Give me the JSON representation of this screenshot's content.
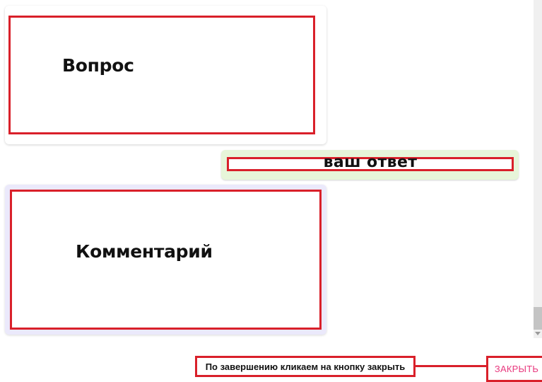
{
  "question": {
    "text": "Вопрос"
  },
  "answer": {
    "text": "ваш ответ"
  },
  "comment": {
    "text": "Комментарий"
  },
  "footer": {
    "instruction": "По завершению кликаем на кнопку закрыть",
    "close_label": "ЗАКРЫТЬ"
  },
  "colors": {
    "annotation_red": "#d9202a",
    "answer_bg": "#e7f5d9",
    "comment_bg": "#ebe9fb",
    "close_text": "#e8397e"
  }
}
